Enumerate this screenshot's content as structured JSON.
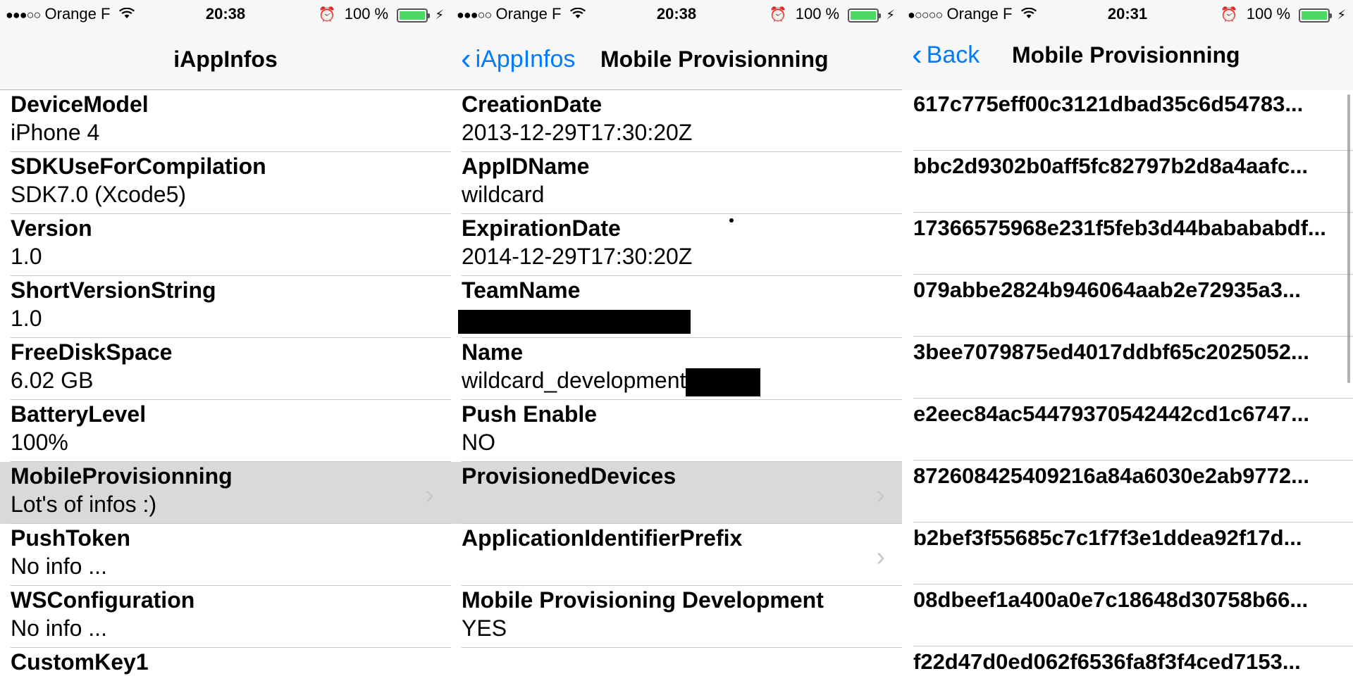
{
  "screens": [
    {
      "status": {
        "signal": "●●●○○",
        "carrier": "Orange F",
        "time": "20:38",
        "battery": "100 %"
      },
      "nav": {
        "title": "iAppInfos"
      },
      "rows": [
        {
          "key": "DeviceModel",
          "value": "iPhone 4"
        },
        {
          "key": "SDKUseForCompilation",
          "value": "SDK7.0 (Xcode5)"
        },
        {
          "key": "Version",
          "value": "1.0"
        },
        {
          "key": "ShortVersionString",
          "value": "1.0"
        },
        {
          "key": "FreeDiskSpace",
          "value": "6.02 GB"
        },
        {
          "key": "BatteryLevel",
          "value": "100%"
        },
        {
          "key": "MobileProvisionning",
          "value": "Lot's of infos :)"
        },
        {
          "key": "PushToken",
          "value": "No info ..."
        },
        {
          "key": "WSConfiguration",
          "value": "No info ..."
        },
        {
          "key": "CustomKey1",
          "value": ""
        }
      ]
    },
    {
      "status": {
        "signal": "●●●○○",
        "carrier": "Orange F",
        "time": "20:38",
        "battery": "100 %"
      },
      "nav": {
        "back": "iAppInfos",
        "title": "Mobile Provisionning"
      },
      "rows": [
        {
          "key": "CreationDate",
          "value": "2013-12-29T17:30:20Z"
        },
        {
          "key": "AppIDName",
          "value": "wildcard"
        },
        {
          "key": "ExpirationDate",
          "value": "2014-12-29T17:30:20Z"
        },
        {
          "key": "TeamName",
          "value": ""
        },
        {
          "key": "Name",
          "value": "wildcard_development"
        },
        {
          "key": "Push Enable",
          "value": "NO"
        },
        {
          "key": "ProvisionedDevices",
          "value": ""
        },
        {
          "key": "ApplicationIdentifierPrefix",
          "value": ""
        },
        {
          "key": "Mobile Provisioning Development",
          "value": "YES"
        }
      ]
    },
    {
      "status": {
        "signal": "●○○○○",
        "carrier": "Orange F",
        "time": "20:31",
        "battery": "100 %"
      },
      "nav": {
        "back": "Back",
        "title": "Mobile Provisionning"
      },
      "rows": [
        "617c775eff00c3121dbad35c6d54783...",
        "bbc2d9302b0aff5fc82797b2d8a4aafc...",
        "17366575968e231f5feb3d44babababdf...",
        "079abbe2824b946064aab2e72935a3...",
        "3bee7079875ed4017ddbf65c2025052...",
        "e2eec84ac54479370542442cd1c6747...",
        "872608425409216a84a6030e2ab9772...",
        "b2bef3f55685c7c1f7f3e1ddea92f17d...",
        "08dbeef1a400a0e7c18648d30758b66...",
        "f22d47d0ed062f6536fa8f3f4ced7153..."
      ]
    }
  ],
  "colors": {
    "accent": "#007aff",
    "battery": "#4cd964",
    "selected_row": "#d9d9d9"
  }
}
